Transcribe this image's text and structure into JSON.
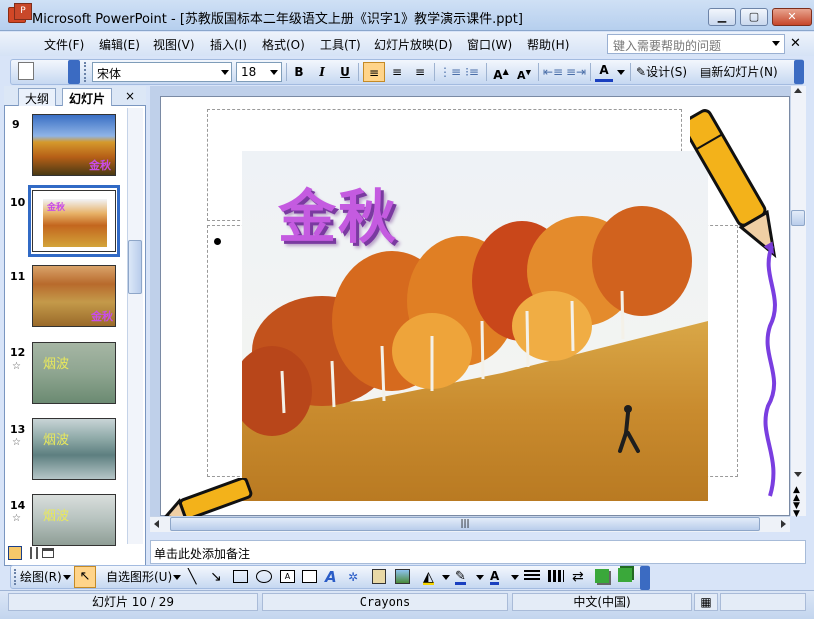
{
  "titlebar": {
    "title": "Microsoft PowerPoint - [苏教版国标本二年级语文上册《识字1》教学演示课件.ppt]",
    "app_icon": "P",
    "minimize": "▁",
    "maximize": "▢",
    "close": "✕"
  },
  "menu": {
    "items": [
      "文件(F)",
      "编辑(E)",
      "视图(V)",
      "插入(I)",
      "格式(O)",
      "工具(T)",
      "幻灯片放映(D)",
      "窗口(W)",
      "帮助(H)"
    ],
    "help_placeholder": "键入需要帮助的问题",
    "close": "✕"
  },
  "format_toolbar": {
    "font": "宋体",
    "size": "18",
    "bold": "B",
    "italic": "I",
    "underline": "U",
    "design": "设计(S)",
    "new_slide": "新幻灯片(N)"
  },
  "left_panel": {
    "tabs": [
      "大纲",
      "幻灯片"
    ],
    "close": "×",
    "slides": [
      {
        "num": "9",
        "label": "金秋",
        "star": false
      },
      {
        "num": "10",
        "label": "金秋",
        "star": false
      },
      {
        "num": "11",
        "label": "金秋",
        "star": false
      },
      {
        "num": "12",
        "label": "烟波",
        "star": true
      },
      {
        "num": "13",
        "label": "烟波",
        "star": true
      },
      {
        "num": "14",
        "label": "烟波",
        "star": true
      }
    ]
  },
  "slide": {
    "title": "金秋"
  },
  "notes": {
    "placeholder": "单击此处添加备注"
  },
  "draw_toolbar": {
    "draw": "绘图(R)",
    "autoshapes": "自选图形(U)"
  },
  "status": {
    "slide_pos": "幻灯片 10 / 29",
    "design": "Crayons",
    "language": "中文(中国)"
  },
  "colors": {
    "accent": "#c45be0",
    "selected_border": "#316ac5"
  }
}
